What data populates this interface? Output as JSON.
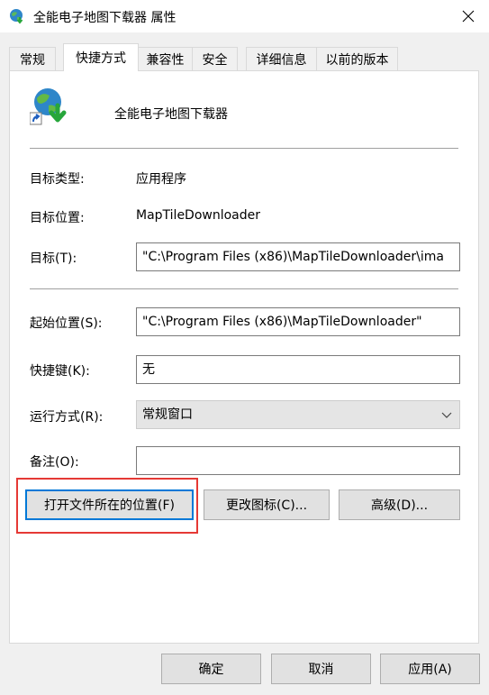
{
  "window": {
    "title": "全能电子地图下载器 属性",
    "icon": "globe-download-icon"
  },
  "tabs": [
    {
      "label": "常规"
    },
    {
      "label": "快捷方式",
      "active": true
    },
    {
      "label": "兼容性"
    },
    {
      "label": "安全"
    },
    {
      "label": "详细信息"
    },
    {
      "label": "以前的版本"
    }
  ],
  "shortcut": {
    "app_name": "全能电子地图下载器",
    "target_type_label": "目标类型:",
    "target_type_value": "应用程序",
    "target_location_label": "目标位置:",
    "target_location_value": "MapTileDownloader",
    "target_label": "目标(T):",
    "target_value": "\"C:\\Program Files (x86)\\MapTileDownloader\\ima",
    "start_in_label": "起始位置(S):",
    "start_in_value": "\"C:\\Program Files (x86)\\MapTileDownloader\"",
    "hotkey_label": "快捷键(K):",
    "hotkey_value": "无",
    "run_label": "运行方式(R):",
    "run_value": "常规窗口",
    "comment_label": "备注(O):",
    "comment_value": ""
  },
  "buttons": {
    "open_location": "打开文件所在的位置(F)",
    "change_icon": "更改图标(C)...",
    "advanced": "高级(D)...",
    "ok": "确定",
    "cancel": "取消",
    "apply": "应用(A)"
  },
  "colors": {
    "highlight": "#e53935",
    "focus": "#0078d7"
  }
}
